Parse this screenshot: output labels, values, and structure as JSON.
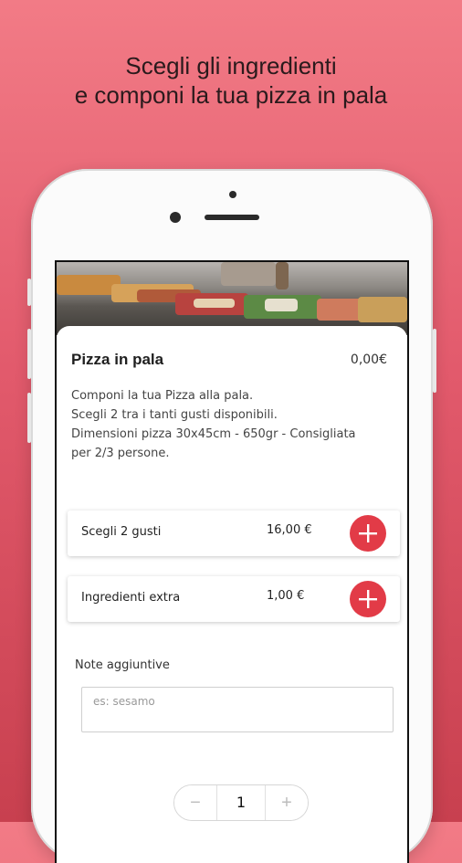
{
  "headline": {
    "line1": "Scegli gli ingredienti",
    "line2": "e componi la tua pizza in pala"
  },
  "product": {
    "name": "Pizza in pala",
    "price": "0,00€",
    "description": [
      "Componi la tua Pizza alla pala.",
      "Scegli 2 tra i tanti gusti disponibili.",
      "Dimensioni pizza 30x45cm - 650gr - Consigliata",
      "per 2/3 persone."
    ]
  },
  "options": [
    {
      "label": "Scegli 2 gusti",
      "price": "16,00 €"
    },
    {
      "label": "Ingredienti extra",
      "price": "1,00 €"
    }
  ],
  "notes": {
    "label": "Note aggiuntive",
    "placeholder": "es: sesamo"
  },
  "quantity": {
    "minus": "−",
    "value": "1",
    "plus": "+"
  },
  "colors": {
    "accent": "#e23b47",
    "background_top": "#f27b86",
    "background_bottom": "#c8404f"
  },
  "icons": {
    "add": "plus-icon"
  }
}
